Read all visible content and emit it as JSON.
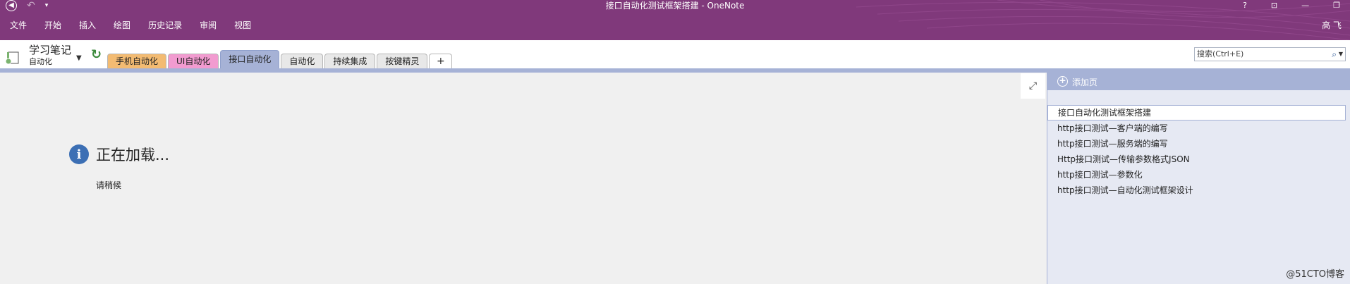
{
  "window": {
    "title": "接口自动化测试框架搭建 - OneNote",
    "controls": [
      "?",
      "⊡",
      "—",
      "❐"
    ]
  },
  "ribbon": {
    "tabs": [
      "文件",
      "开始",
      "插入",
      "绘图",
      "历史记录",
      "审阅",
      "视图"
    ],
    "user": "高 飞"
  },
  "notebook": {
    "name": "学习笔记",
    "section": "自动化"
  },
  "sections": [
    {
      "label": "手机自动化",
      "color": "#f3bb72",
      "active": false
    },
    {
      "label": "UI自动化",
      "color": "#f29bd0",
      "active": false
    },
    {
      "label": "接口自动化",
      "color": "#a6b2d6",
      "active": true
    },
    {
      "label": "自动化",
      "color": "#e8e8e8",
      "active": false
    },
    {
      "label": "持续集成",
      "color": "#e8e8e8",
      "active": false
    },
    {
      "label": "按键精灵",
      "color": "#e8e8e8",
      "active": false
    }
  ],
  "add_section": "+",
  "search": {
    "placeholder": "搜索(Ctrl+E)"
  },
  "main": {
    "loading": "正在加载...",
    "wait": "请稍候"
  },
  "pane": {
    "add_page": "添加页",
    "pages": [
      "接口自动化测试框架搭建",
      "http接口测试—客户端的编写",
      "http接口测试—服务端的编写",
      "Http接口测试—传输参数格式JSON",
      "http接口测试—参数化",
      "http接口测试—自动化测试框架设计"
    ],
    "selected_index": 0
  },
  "watermark": "@51CTO博客",
  "colors": {
    "accent": "#80397b",
    "section_blue": "#a6b2d6"
  }
}
